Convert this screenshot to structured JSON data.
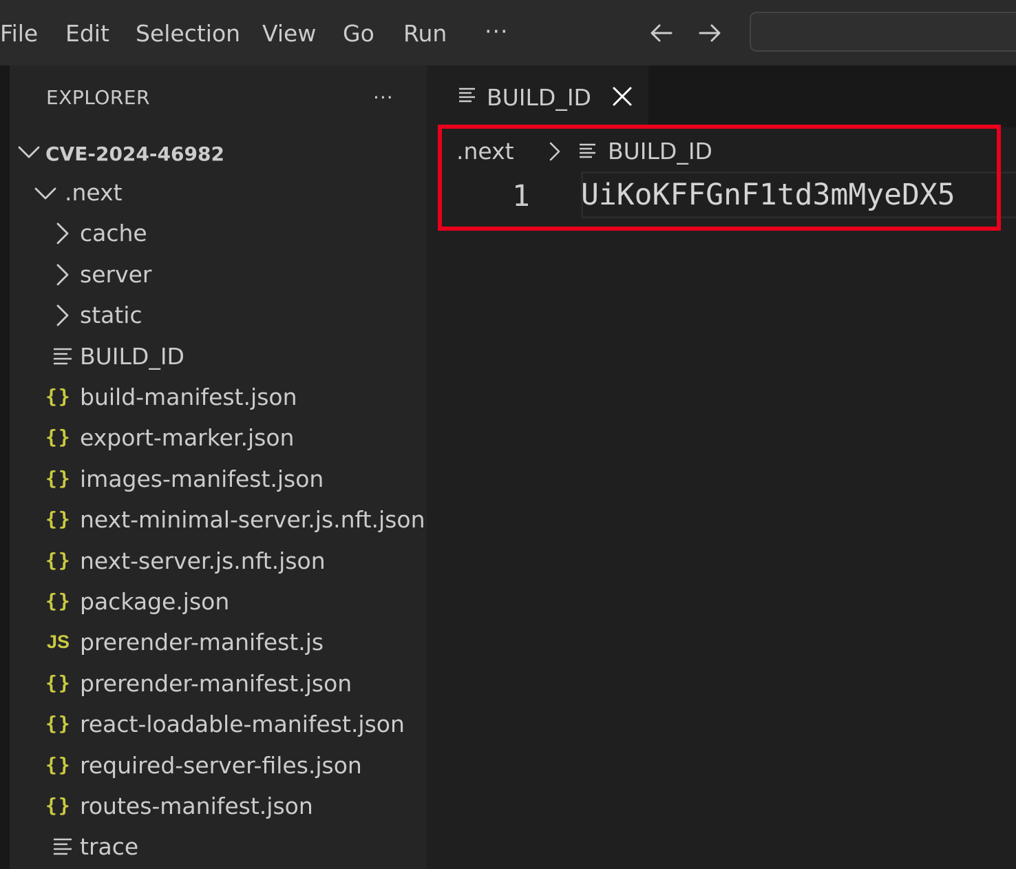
{
  "menu": {
    "items": [
      "File",
      "Edit",
      "Selection",
      "View",
      "Go",
      "Run"
    ],
    "more": "···"
  },
  "sidebar": {
    "title": "EXPLORER",
    "more": "···",
    "root": "CVE-2024-46982",
    "next_folder": ".next",
    "folders": [
      "cache",
      "server",
      "static"
    ],
    "files": [
      {
        "name": "BUILD_ID",
        "icon": "lines-icon"
      },
      {
        "name": "build-manifest.json",
        "icon": "json-icon"
      },
      {
        "name": "export-marker.json",
        "icon": "json-icon"
      },
      {
        "name": "images-manifest.json",
        "icon": "json-icon"
      },
      {
        "name": "next-minimal-server.js.nft.json",
        "icon": "json-icon"
      },
      {
        "name": "next-server.js.nft.json",
        "icon": "json-icon"
      },
      {
        "name": "package.json",
        "icon": "json-icon"
      },
      {
        "name": "prerender-manifest.js",
        "icon": "js-icon"
      },
      {
        "name": "prerender-manifest.json",
        "icon": "json-icon"
      },
      {
        "name": "react-loadable-manifest.json",
        "icon": "json-icon"
      },
      {
        "name": "required-server-files.json",
        "icon": "json-icon"
      },
      {
        "name": "routes-manifest.json",
        "icon": "json-icon"
      },
      {
        "name": "trace",
        "icon": "lines-icon"
      }
    ],
    "json_glyph": "{}",
    "js_glyph": "JS"
  },
  "editor": {
    "tab_label": "BUILD_ID",
    "breadcrumb": {
      "folder": ".next",
      "file": "BUILD_ID"
    },
    "line_number": "1",
    "code": "UiKoKFFGnF1td3mMyeDX5"
  },
  "colors": {
    "annotation": "#e8001c",
    "json_icon": "#cbcb41",
    "background": "#1f1f1f",
    "sidebar": "#252526"
  }
}
